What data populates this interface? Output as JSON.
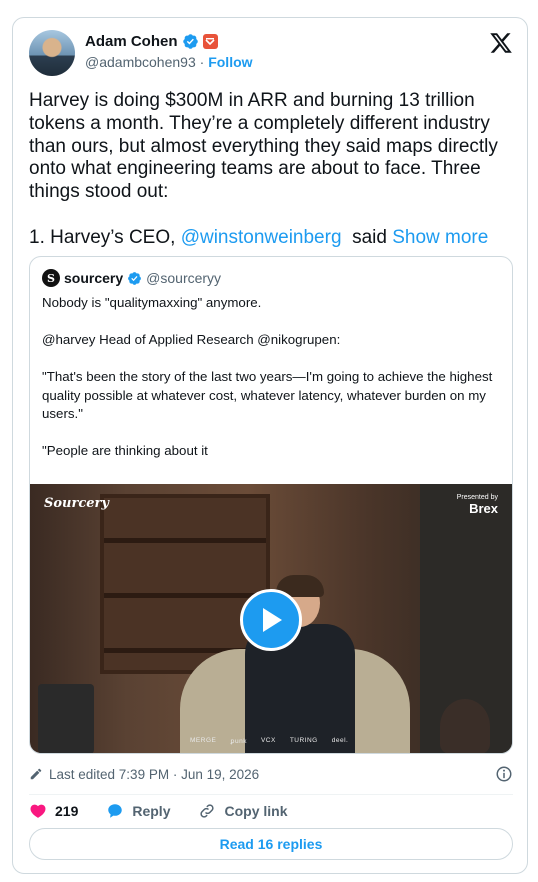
{
  "author": {
    "name": "Adam Cohen",
    "handle": "@adambcohen93",
    "follow_label": "Follow"
  },
  "tweet": {
    "paragraph1": "Harvey is doing $300M in ARR and burning 13 trillion tokens a month. They’re a completely different industry than ours, but almost everything they said maps directly onto what engineering teams are about to face. Three things stood out:",
    "p2_prefix": "1. Harvey’s CEO, ",
    "p2_mention": "@winstonweinberg",
    "p2_suffix": "  said ",
    "show_more": "Show more"
  },
  "quote": {
    "name": "sourcery",
    "handle": "@sourceryy",
    "logo_letter": "S",
    "lines": [
      "Nobody is \"qualitymaxxing\" anymore.",
      "@harvey Head of Applied Research @nikogrupen:",
      "\"That's been the story of the last two years—I'm going to achieve the highest quality possible at whatever cost, whatever latency, whatever burden on my users.\"",
      "\"People are thinking about it"
    ],
    "video": {
      "brand": "Sourcery",
      "presented_by": "Presented by",
      "sponsor": "Brex",
      "sponsors_row": [
        "MERGE",
        "ꝑunk",
        "VCX",
        "TURING",
        "deel."
      ]
    }
  },
  "meta": {
    "edited": "Last edited 7:39 PM · Jun 19, 2026"
  },
  "actions": {
    "likes": "219",
    "reply": "Reply",
    "copy_link": "Copy link"
  },
  "read_replies": "Read 16 replies",
  "colors": {
    "accent": "#1d9bf0",
    "like": "#f91880",
    "text": "#0f1419",
    "muted": "#536471"
  }
}
